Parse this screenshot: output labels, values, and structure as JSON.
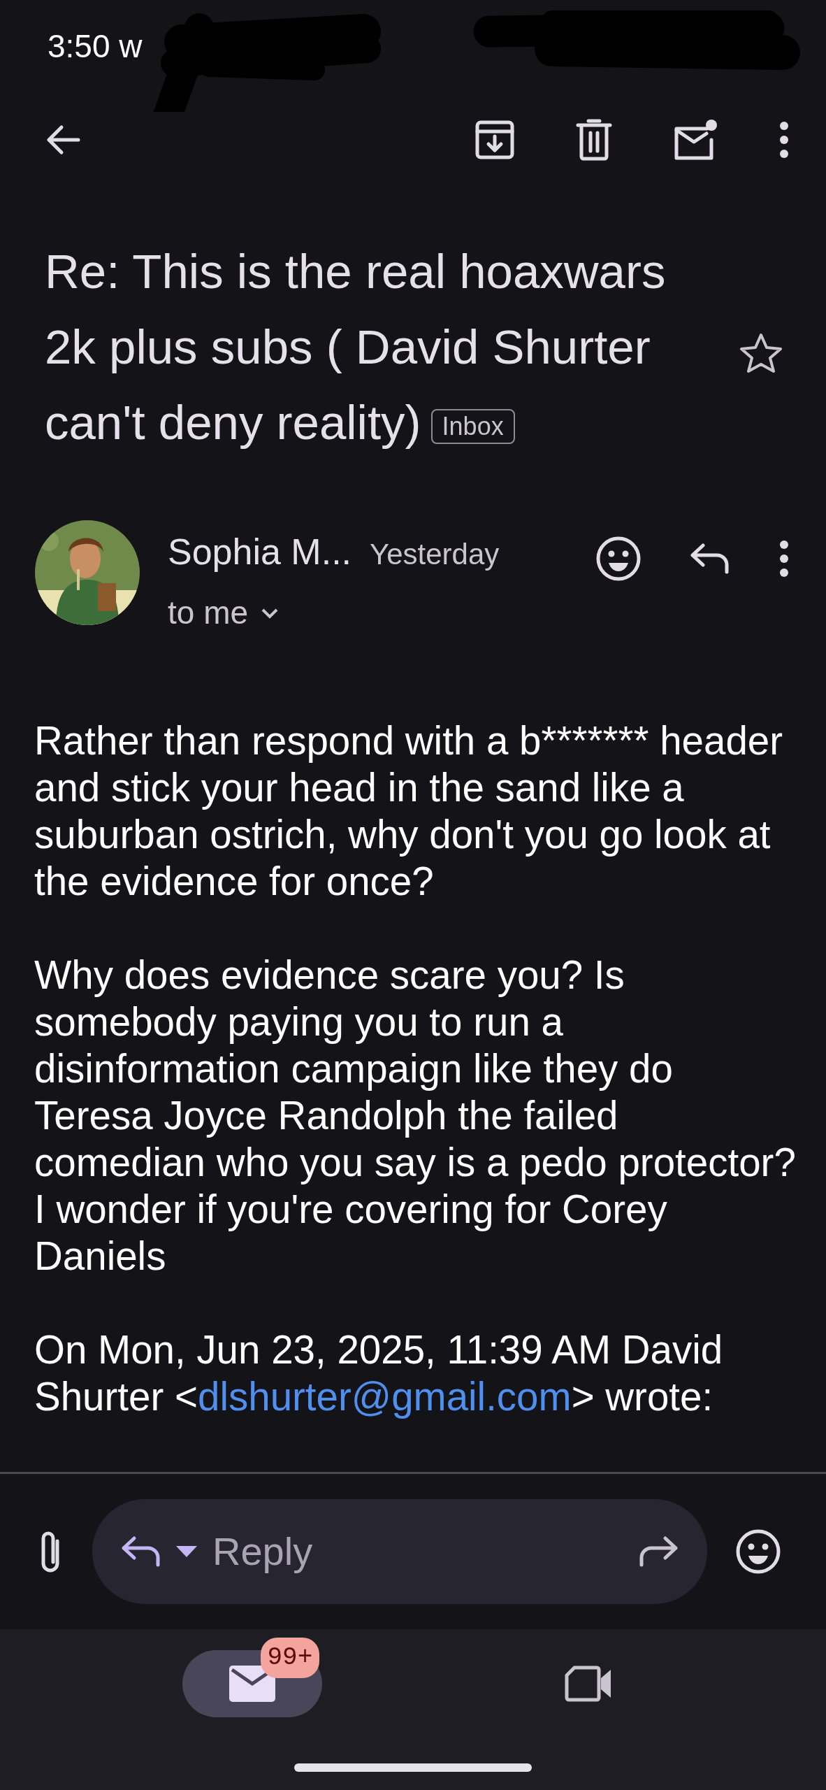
{
  "status_bar": {
    "time": "3:50 w"
  },
  "subject": {
    "title_lines": [
      "Re: This is the real hoaxwars",
      "2k plus subs ( David Shurter",
      "can't deny reality)"
    ],
    "label": "Inbox",
    "starred": false
  },
  "message": {
    "sender": "Sophia M...",
    "time": "Yesterday",
    "recipient": "to me",
    "paragraphs": [
      {
        "lines": [
          "Rather than respond with a b******* header and stick your head in the sand like a suburban ostrich, why don't you go look at the evidence for once?"
        ]
      },
      {
        "lines": [
          "Why does evidence scare you? Is somebody paying you to run a disinformation campaign like they do Teresa Joyce Randolph the failed comedian who you say is a pedo protector?",
          "I wonder if you're covering for Corey Daniels"
        ]
      }
    ],
    "quote_header": {
      "before": "On Mon, Jun 23, 2025, 11:39 AM David Shurter <",
      "email": "dlshurter@gmail.com",
      "after": "> wrote:"
    }
  },
  "reply_bar": {
    "placeholder": "Reply"
  },
  "bottom_nav": [
    {
      "selected": true,
      "badge": "99+"
    },
    {
      "selected": false
    }
  ]
}
